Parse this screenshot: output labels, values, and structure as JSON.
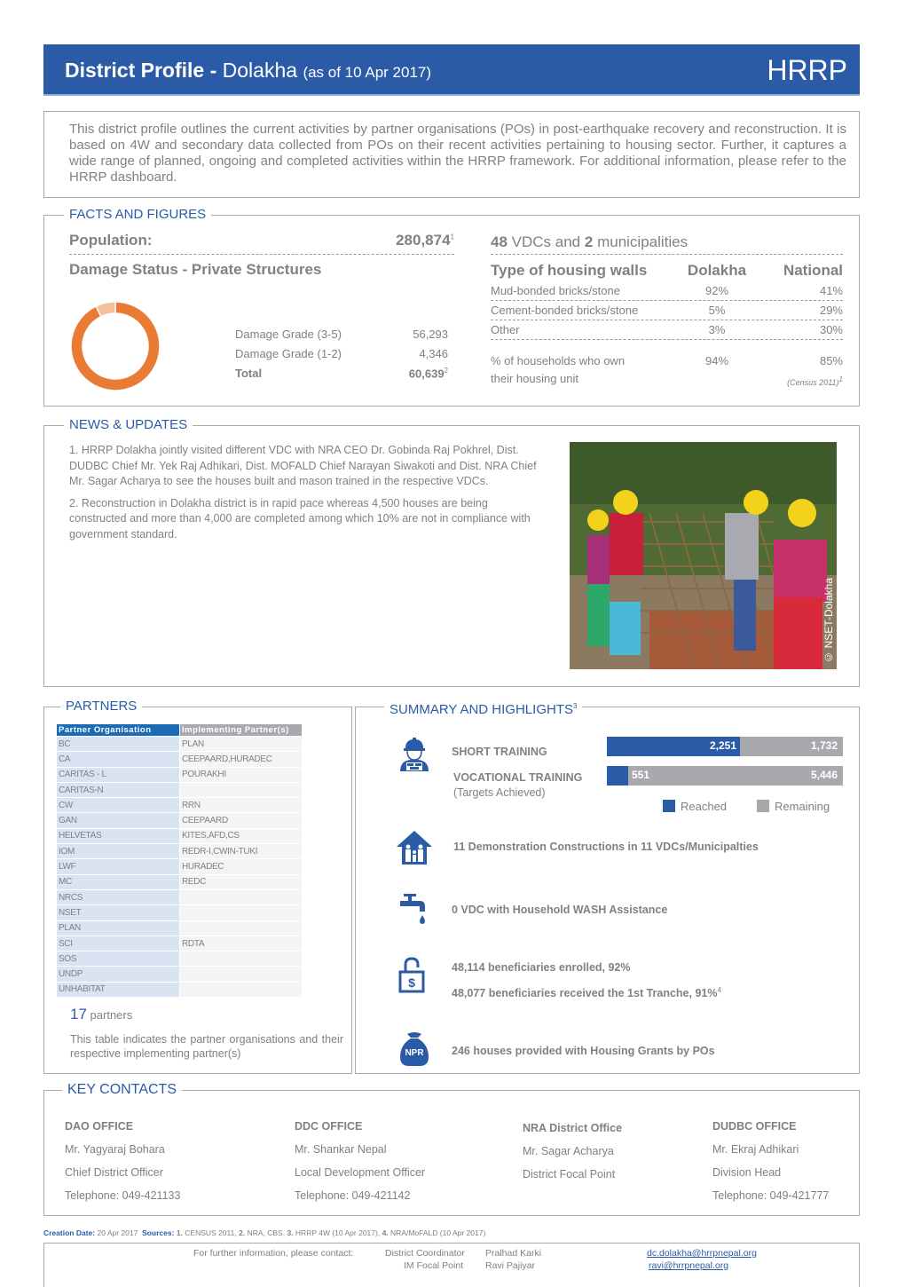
{
  "header": {
    "title_bold": "District Profile -",
    "district": "Dolakha",
    "as_of": "(as of 10 Apr 2017)",
    "brand": "HRRP"
  },
  "intro": "This district profile outlines the current activities by partner organisations (POs) in post-earthquake recovery and reconstruction. It is based on 4W and secondary data collected from POs on their recent activities pertaining to housing sector. Further, it captures a wide range of planned, ongoing and completed activities within the HRRP framework. For additional information, please refer to the HRRP dashboard.",
  "facts": {
    "section_title": "FACTS AND FIGURES",
    "population_label": "Population:",
    "population_value": "280,874",
    "population_note": "1",
    "damage_title": "Damage Status - Private Structures",
    "damage_rows": [
      {
        "label": "Damage Grade (3-5)",
        "value": "56,293"
      },
      {
        "label": "Damage Grade (1-2)",
        "value": "4,346"
      }
    ],
    "damage_total_label": "Total",
    "damage_total_value": "60,639",
    "damage_total_note": "2",
    "vdc_count": "48",
    "vdc_text": "VDCs and",
    "muni_count": "2",
    "muni_text": "municipalities",
    "walls_header": [
      "Type of housing walls",
      "Dolakha",
      "National"
    ],
    "walls_rows": [
      {
        "type": "Mud-bonded bricks/stone",
        "dolakha": "92%",
        "national": "41%"
      },
      {
        "type": "Cement-bonded bricks/stone",
        "dolakha": "5%",
        "national": "29%"
      },
      {
        "type": "Other",
        "dolakha": "3%",
        "national": "30%"
      }
    ],
    "own_label_1": "% of households who own",
    "own_label_2": "their housing unit",
    "own_dolakha": "94%",
    "own_national": "85%",
    "own_source": "(Census 2011)",
    "own_source_note": "1"
  },
  "chart_data": {
    "type": "pie",
    "title": "Damage Status - Private Structures",
    "categories": [
      "Damage Grade (3-5)",
      "Damage Grade (1-2)"
    ],
    "values": [
      56293,
      4346
    ],
    "colors": [
      "#e97b35",
      "#f5bf9c"
    ],
    "donut": true
  },
  "news": {
    "section_title": "NEWS & UPDATES",
    "items": [
      "1.  HRRP Dolakha jointly visited different VDC with NRA CEO Dr. Gobinda Raj Pokhrel, Dist. DUDBC Chief Mr. Yek Raj Adhikari, Dist. MOFALD Chief Narayan Siwakoti and Dist. NRA Chief Mr. Sagar Acharya to see the houses built and mason trained in the respective VDCs.",
      "2.  Reconstruction in Dolakha district is in rapid pace whereas 4,500 houses are being constructed and more than 4,000 are completed among which 10% are not in compliance with government standard."
    ],
    "photo_credit": "© NSET-Dolakha"
  },
  "partners": {
    "section_title": "PARTNERS",
    "col_org": "Partner Organisation",
    "col_impl": "Implementing Partner(s)",
    "rows": [
      {
        "org": "BC",
        "impl": "PLAN"
      },
      {
        "org": "CA",
        "impl": "CEEPAARD,HURADEC"
      },
      {
        "org": "CARITAS - L",
        "impl": "POURAKHI"
      },
      {
        "org": "CARITAS-N",
        "impl": ""
      },
      {
        "org": "CW",
        "impl": "RRN"
      },
      {
        "org": "GAN",
        "impl": "CEEPAARD"
      },
      {
        "org": "HELVETAS",
        "impl": "KITES,AFD,CS"
      },
      {
        "org": "IOM",
        "impl": "REDR-I,CWIN-TUKI"
      },
      {
        "org": "LWF",
        "impl": "HURADEC"
      },
      {
        "org": "MC",
        "impl": "REDC"
      },
      {
        "org": "NRCS",
        "impl": ""
      },
      {
        "org": "NSET",
        "impl": ""
      },
      {
        "org": "PLAN",
        "impl": ""
      },
      {
        "org": "SCI",
        "impl": "RDTA"
      },
      {
        "org": "SOS",
        "impl": ""
      },
      {
        "org": "UNDP",
        "impl": ""
      },
      {
        "org": "UNHABITAT",
        "impl": ""
      }
    ],
    "count": "17",
    "count_label": "partners",
    "note": "This table indicates the partner organisations and their respective implementing partner(s)"
  },
  "summary": {
    "section_title": "SUMMARY AND HIGHLIGHTS",
    "section_note": "3",
    "short_training_label": "SHORT TRAINING",
    "vocational_training_label": "VOCATIONAL TRAINING",
    "targets_label": "(Targets Achieved)",
    "trainings": [
      {
        "name": "SHORT TRAINING",
        "reached": 2251,
        "remaining": 1732,
        "reached_label": "2,251",
        "remaining_label": "1,732"
      },
      {
        "name": "VOCATIONAL TRAINING",
        "reached": 551,
        "remaining": 5446,
        "reached_label": "551",
        "remaining_label": "5,446"
      }
    ],
    "legend_reached": "Reached",
    "legend_remaining": "Remaining",
    "colors": {
      "reached": "#2b5ba6",
      "remaining": "#a7a9ac"
    },
    "demo_text": "11 Demonstration Constructions in 11 VDCs/Municipalties",
    "wash_text": "0 VDC with Household WASH Assistance",
    "enrolled_text": "48,114 beneficiaries enrolled, 92%",
    "tranche_text": "48,077 beneficiaries received the 1st Tranche, 91%",
    "tranche_note": "4",
    "grants_text": "246 houses provided with Housing Grants by POs",
    "npr_label": "NPR"
  },
  "contacts": {
    "section_title": "KEY CONTACTS",
    "offices": [
      {
        "office": "DAO OFFICE",
        "name": "Mr. Yagyaraj Bohara",
        "role": "Chief District Officer",
        "phone": "Telephone: 049-421133"
      },
      {
        "office": "DDC OFFICE",
        "name": "Mr. Shankar Nepal",
        "role": "Local Development Officer",
        "phone": "Telephone: 049-421142"
      },
      {
        "office": "NRA District Office",
        "name": "Mr. Sagar Acharya",
        "role": "District Focal Point",
        "phone": ""
      },
      {
        "office": "DUDBC OFFICE",
        "name": "Mr. Ekraj Adhikari",
        "role": "Division Head",
        "phone": "Telephone: 049-421777"
      }
    ]
  },
  "footer": {
    "creation_label": "Creation Date:",
    "creation_date": "20 Apr 2017",
    "sources_label": "Sources:",
    "sources": [
      {
        "n": "1.",
        "t": "CENSUS 2011,"
      },
      {
        "n": "2.",
        "t": "NRA, CBS,"
      },
      {
        "n": "3.",
        "t": "HRRP 4W (10 Apr 2017),"
      },
      {
        "n": "4.",
        "t": "NRA/MoFALD (10 Apr 2017)"
      }
    ],
    "contact_intro": "For further information, please contact:",
    "contacts": [
      {
        "role": "District Coordinator",
        "name": "Pralhad Karki",
        "email": "dc.dolakha@hrrpnepal.org"
      },
      {
        "role": "IM Focal Point",
        "name": "Ravi Pajiyar",
        "email": "ravi@hrrpnepal.org"
      }
    ]
  }
}
